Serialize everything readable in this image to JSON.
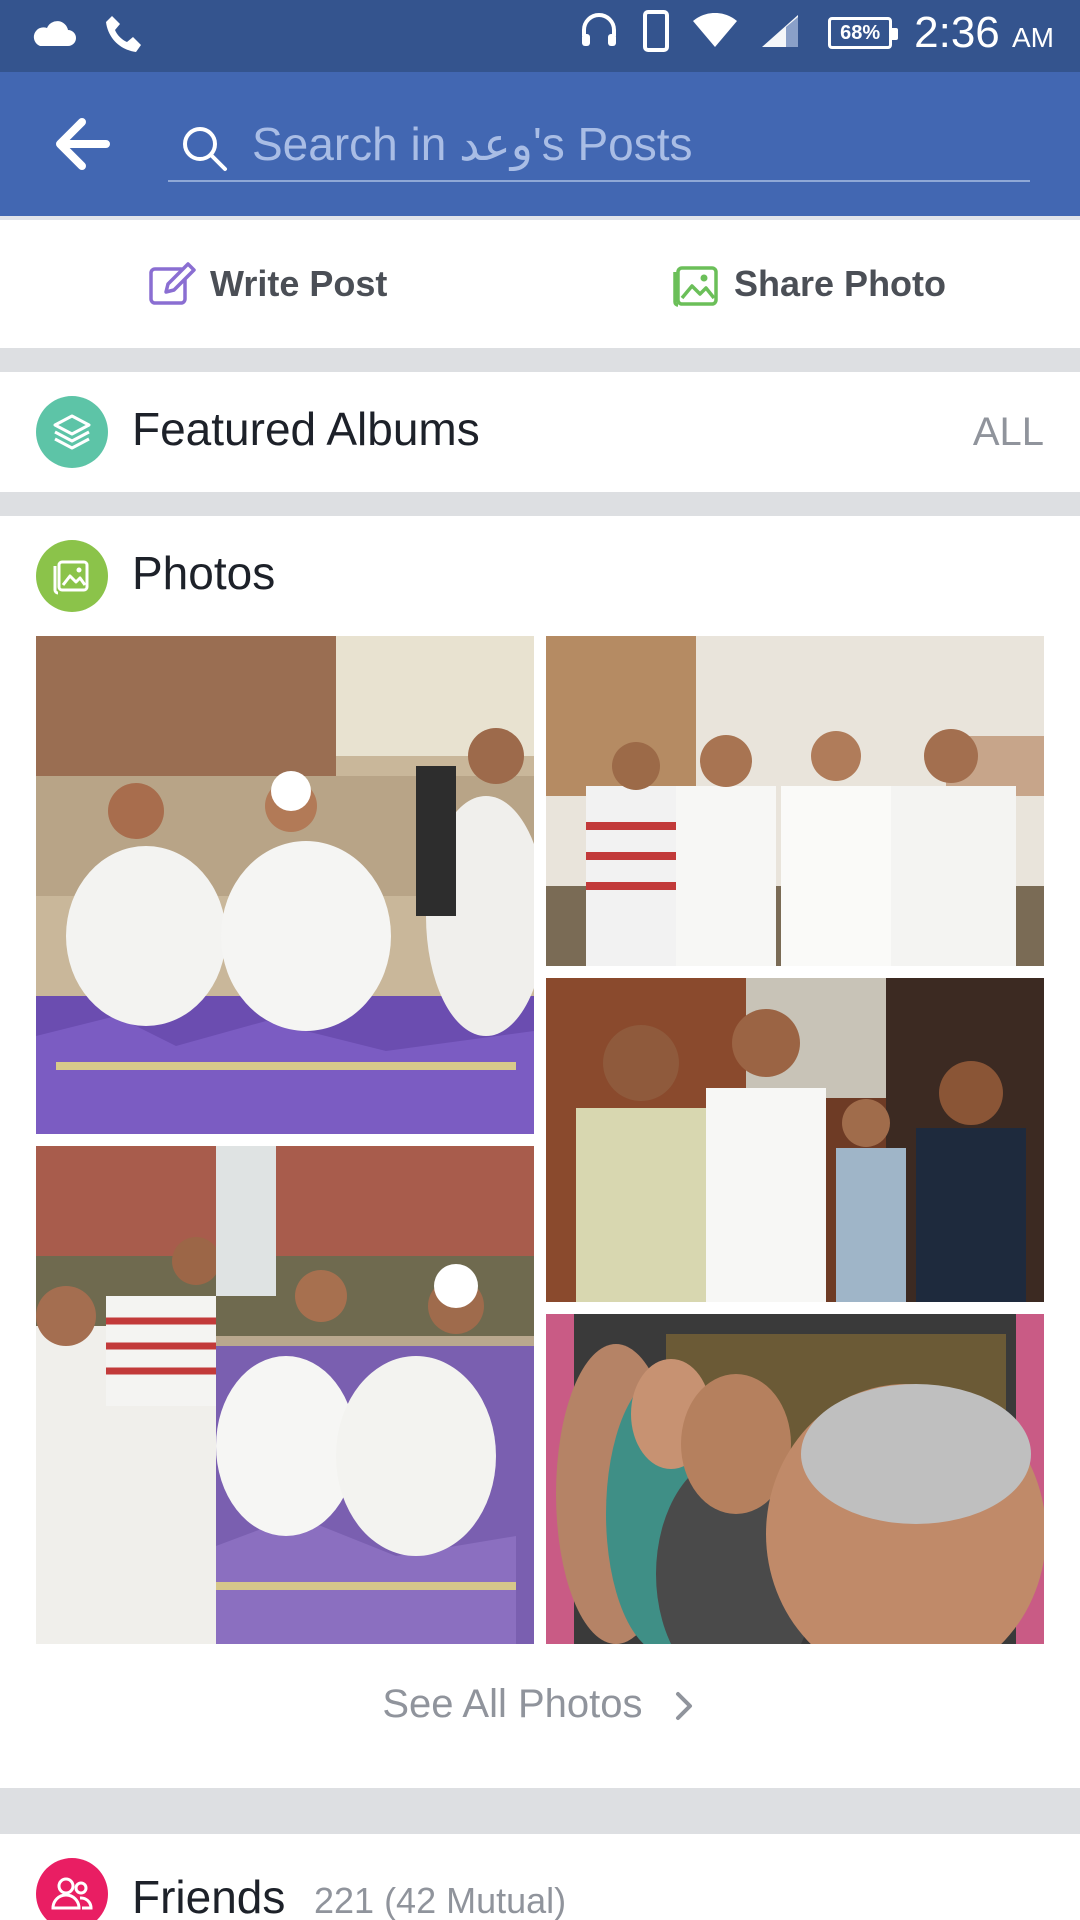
{
  "status_bar": {
    "battery": "68%",
    "time": "2:36",
    "ampm": "AM"
  },
  "search": {
    "placeholder": "Search in وعد's Posts"
  },
  "actions": {
    "write_post": "Write Post",
    "share_photo": "Share Photo"
  },
  "featured_albums": {
    "title": "Featured Albums",
    "all_label": "ALL"
  },
  "photos": {
    "title": "Photos",
    "see_all": "See All Photos"
  },
  "friends": {
    "title": "Friends",
    "count": "221 (42 Mutual)"
  },
  "colors": {
    "status_bar": "#34548e",
    "header": "#4267b2",
    "albums_icon": "#5dc4a7",
    "photos_icon": "#8bc34a",
    "friends_icon": "#e91e63"
  }
}
